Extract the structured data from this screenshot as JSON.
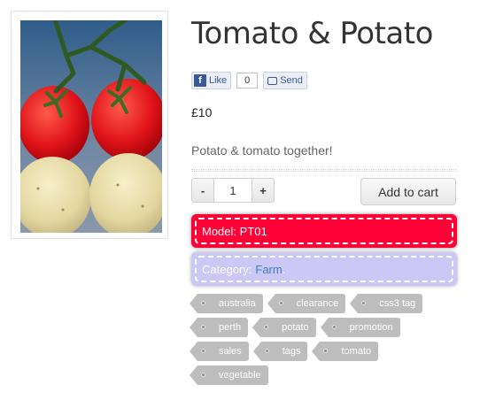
{
  "product": {
    "title": "Tomato & Potato",
    "price": "£10",
    "description": "Potato & tomato together!",
    "image_icon": "tomato-potato-photo"
  },
  "social": {
    "like_label": "Like",
    "like_count": "0",
    "send_label": "Send",
    "fb_letter": "f"
  },
  "purchase": {
    "minus_label": "-",
    "quantity": "1",
    "plus_label": "+",
    "add_to_cart_label": "Add to cart"
  },
  "model": {
    "label": "Model:",
    "value": "PT01"
  },
  "category": {
    "label": "Category:",
    "value": "Farm"
  },
  "tags": [
    [
      "australia",
      "clearance",
      "css3 tag"
    ],
    [
      "perth",
      "potato",
      "promotion"
    ],
    [
      "sales",
      "tags",
      "tomato"
    ],
    [
      "vegetable"
    ]
  ],
  "colors": {
    "model_bg": "#ff0037",
    "category_bg": "#cbc8f5",
    "category_link": "#3f7cc7",
    "tag_bg": "#bdbdbd"
  }
}
